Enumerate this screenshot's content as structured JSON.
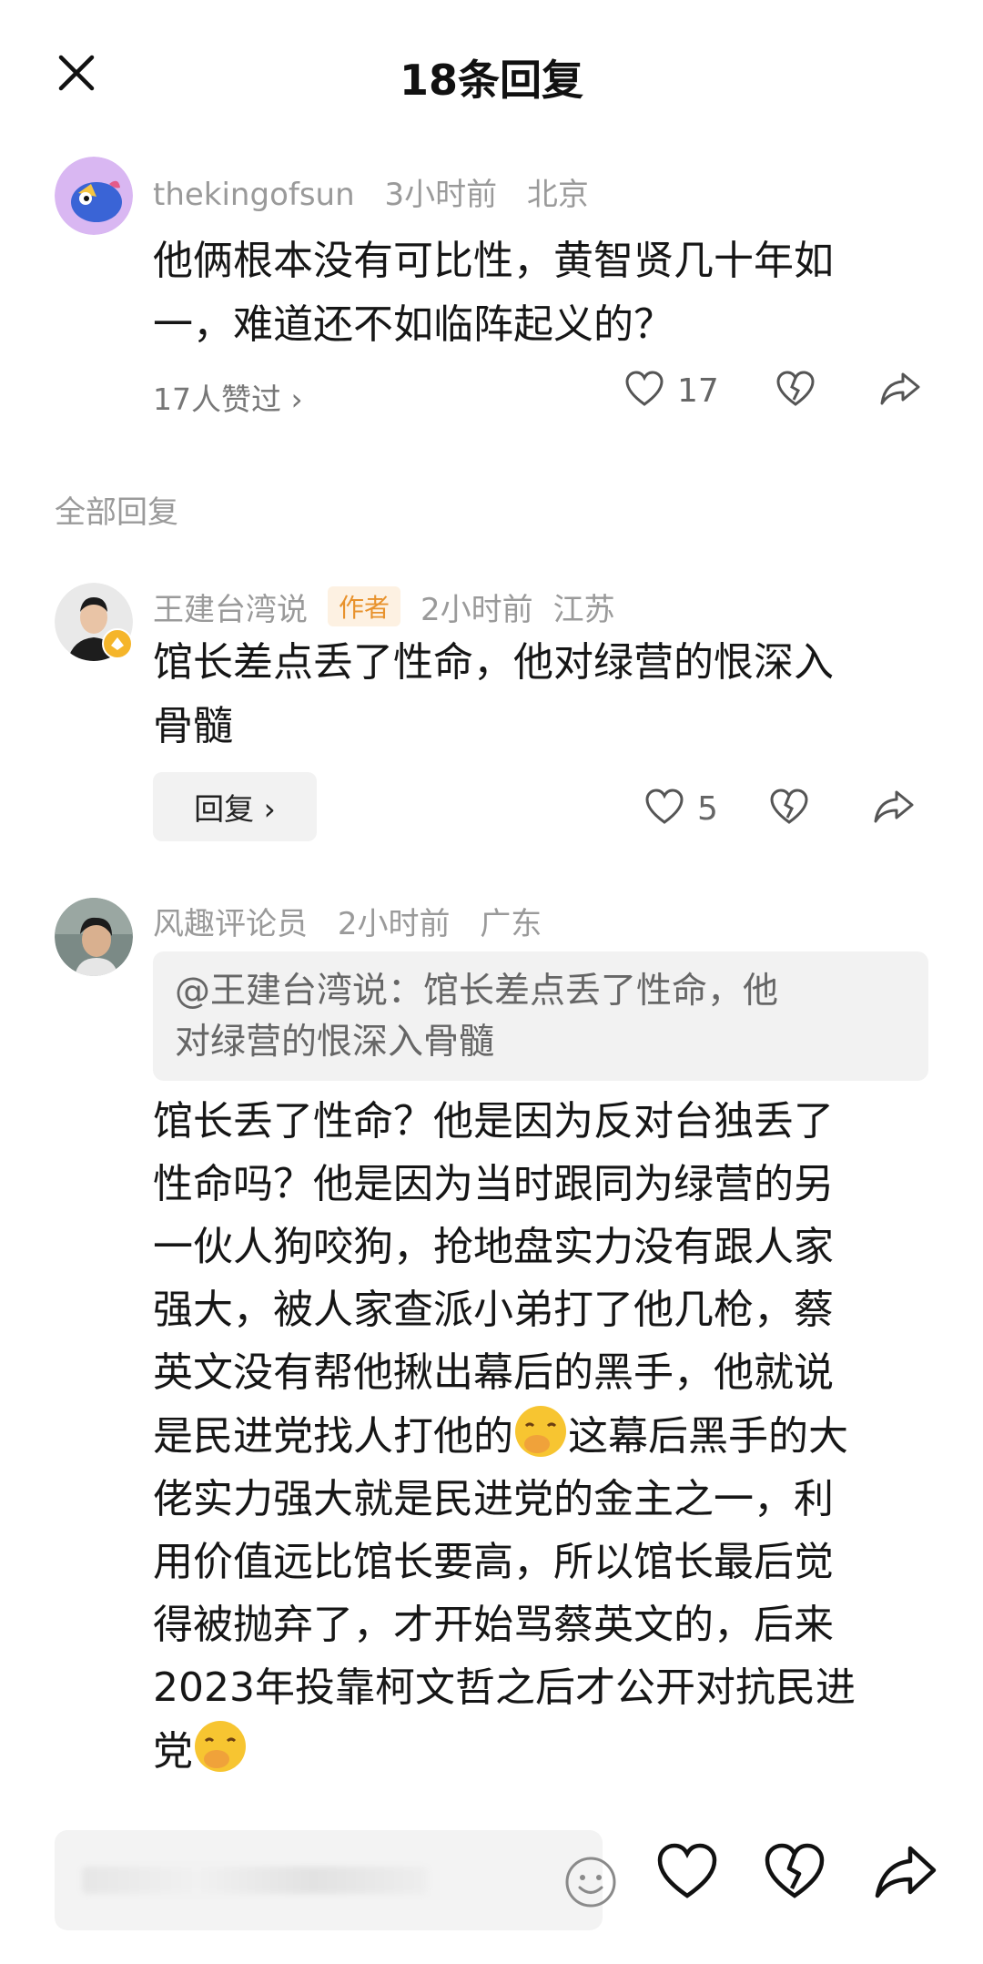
{
  "header": {
    "title": "18条回复",
    "close_icon": "close-icon"
  },
  "main_comment": {
    "username": "thekingofsun",
    "time": "3小时前",
    "location": "北京",
    "text_line1": "他俩根本没有可比性，黄智贤几十年如",
    "text_line2": "一，难道还不如临阵起义的？",
    "likers": "17人赞过 ›",
    "like_count": "17"
  },
  "section_label": "全部回复",
  "reply1": {
    "username": "王建台湾说",
    "badge": "作者",
    "time": "2小时前",
    "location": "江苏",
    "text_line1": "馆长差点丢了性命，他对绿营的恨深入",
    "text_line2": "骨髓",
    "reply_button": "回复 ›",
    "like_count": "5"
  },
  "reply2": {
    "username": "风趣评论员",
    "time": "2小时前",
    "location": "广东",
    "quote_line1": "@王建台湾说：馆长差点丢了性命，他",
    "quote_line2": "对绿营的恨深入骨髓",
    "lines": [
      "馆长丢了性命？他是因为反对台独丢了",
      "性命吗？他是因为当时跟同为绿营的另",
      "一伙人狗咬狗，抢地盘实力没有跟人家",
      "强大，被人家查派小弟打了他几枪，蔡",
      "英文没有帮他揪出幕后的黑手，他就说"
    ],
    "line6_a": "是民进党找人打他的",
    "line6_b": "这幕后黑手的大",
    "lines_after": [
      "佬实力强大就是民进党的金主之一，利",
      "用价值远比馆长要高，所以馆长最后觉",
      "得被抛弃了，才开始骂蔡英文的，后来",
      "2023年投靠柯文哲之后才公开对抗民进"
    ],
    "last_line": "党"
  },
  "colors": {
    "meta_gray": "#9a9a9a",
    "badge_bg": "#fdf1e2",
    "badge_text": "#e8922c",
    "button_bg": "#f2f2f2"
  }
}
